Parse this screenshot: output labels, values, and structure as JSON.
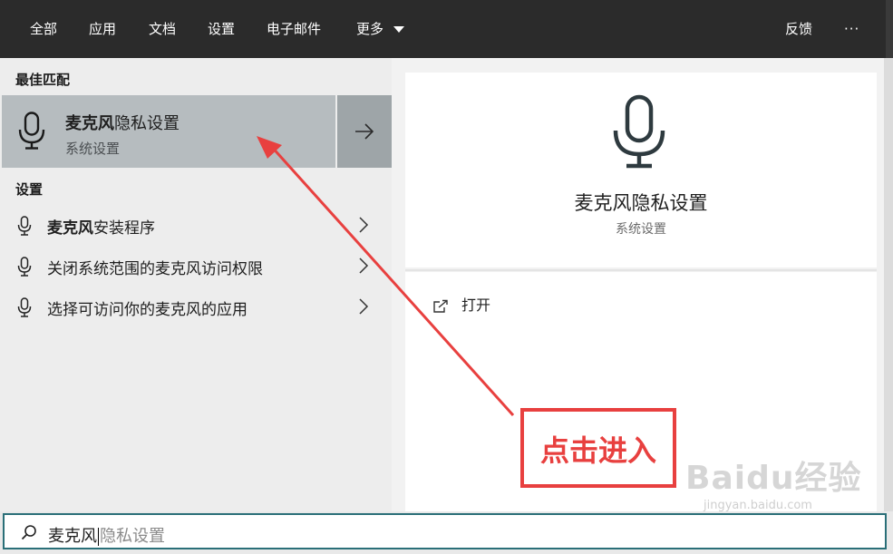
{
  "tabs": {
    "all": "全部",
    "apps": "应用",
    "documents": "文档",
    "settings": "设置",
    "email": "电子邮件",
    "more": "更多",
    "feedback": "反馈",
    "ellipsis": "···"
  },
  "best_match": {
    "header": "最佳匹配",
    "title_bold": "麦克风",
    "title_rest": "隐私设置",
    "subtitle": "系统设置"
  },
  "settings_section": {
    "header": "设置",
    "items": [
      {
        "bold": "麦克风",
        "rest": "安装程序"
      },
      {
        "bold": "",
        "rest": "关闭系统范围的麦克风访问权限"
      },
      {
        "bold": "",
        "rest": "选择可访问你的麦克风的应用"
      }
    ]
  },
  "preview": {
    "title": "麦克风隐私设置",
    "subtitle": "系统设置",
    "open_action": "打开"
  },
  "search": {
    "query": "麦克风",
    "suggestion": "隐私设置"
  },
  "annotation": {
    "text": "点击进入",
    "color": "#e8403f"
  },
  "watermark": {
    "logo": "Baidu经验",
    "url": "jingyan.baidu.com"
  },
  "colors": {
    "topbar": "#2b2b2b",
    "selected_row": "#b6bcbf",
    "search_border": "#2a6f78"
  }
}
